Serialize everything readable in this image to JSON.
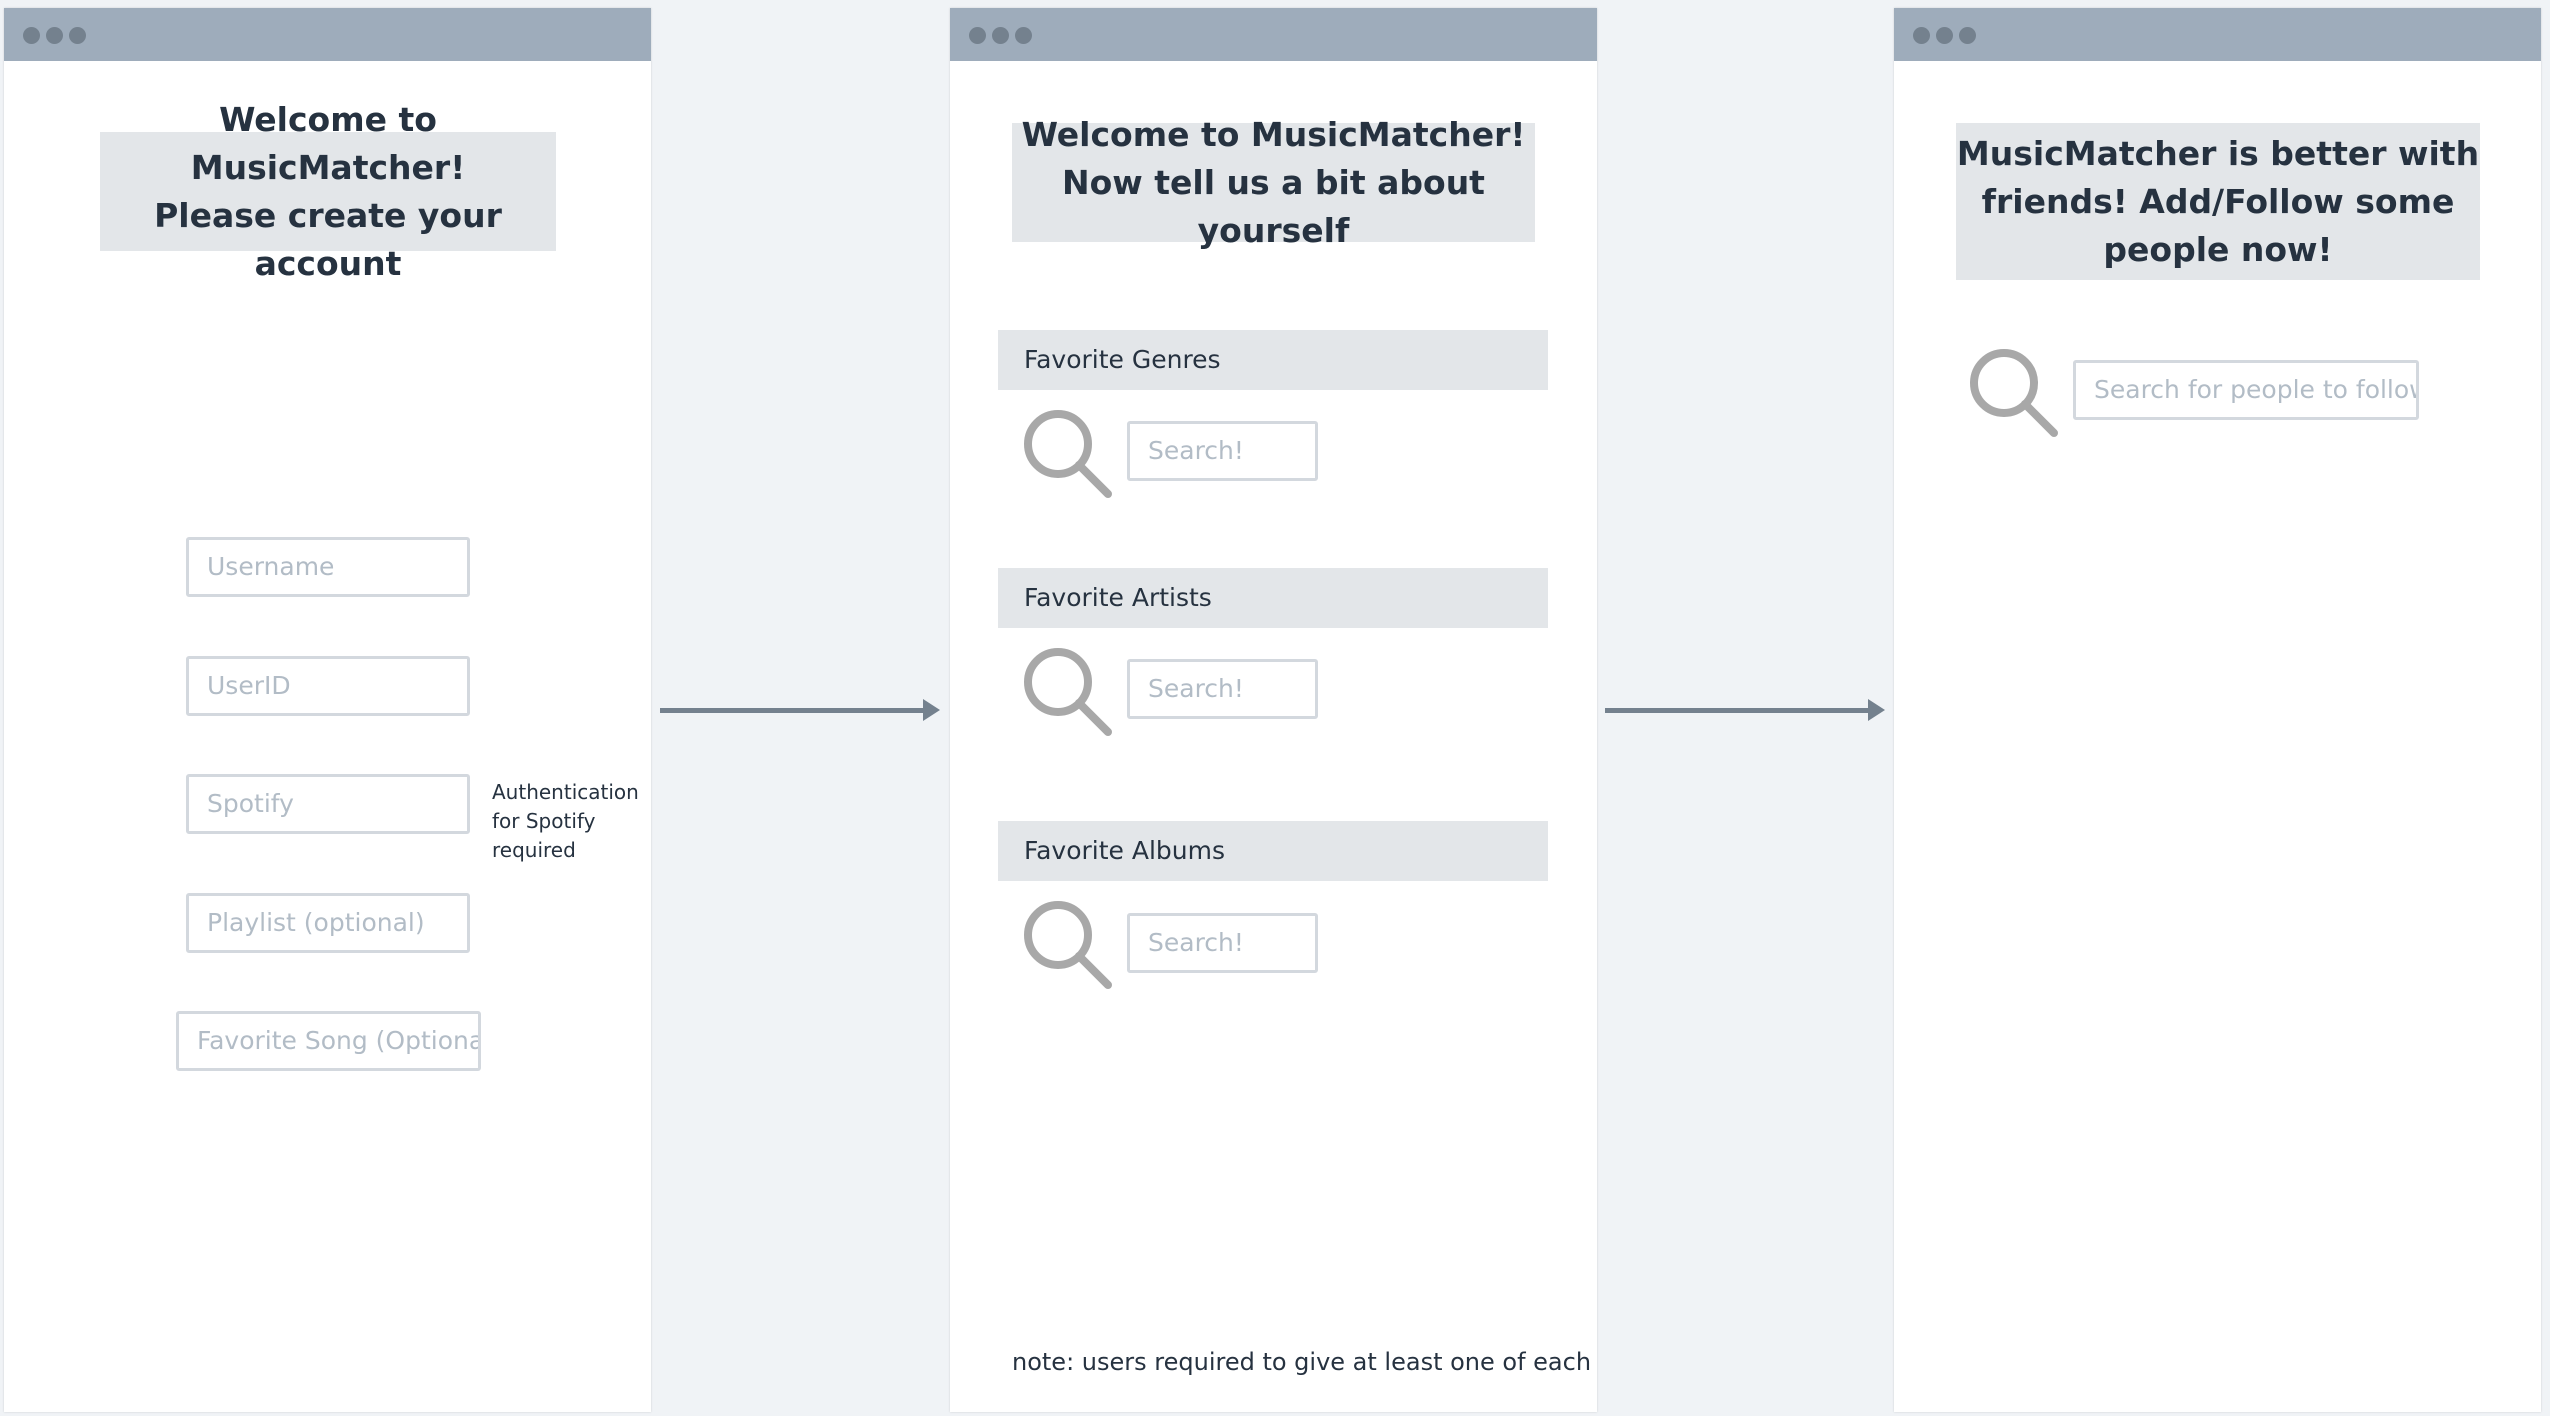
{
  "screens": [
    {
      "banner": {
        "line1": "Welcome to MusicMatcher!",
        "line2": "Please create your account"
      },
      "fields": [
        {
          "placeholder": "Username"
        },
        {
          "placeholder": "UserID"
        },
        {
          "placeholder": "Spotify"
        },
        {
          "placeholder": "Playlist (optional)"
        },
        {
          "placeholder": "Favorite Song (Optional"
        }
      ],
      "spotify_note": {
        "line1": "Authentication",
        "line2": "for Spotify",
        "line3": "required"
      }
    },
    {
      "banner": {
        "line1": "Welcome to MusicMatcher!",
        "line2": "Now tell us a bit about yourself"
      },
      "sections": [
        {
          "label": "Favorite Genres",
          "search_placeholder": "Search!",
          "icon": "magnifier-icon"
        },
        {
          "label": "Favorite Artists",
          "search_placeholder": "Search!",
          "icon": "magnifier-icon"
        },
        {
          "label": "Favorite Albums",
          "search_placeholder": "Search!",
          "icon": "magnifier-icon"
        }
      ],
      "note": "note: users required to give at least one of each"
    },
    {
      "banner": {
        "line1": "MusicMatcher is better with",
        "line2": "friends! Add/Follow some",
        "line3": "people now!"
      },
      "search_placeholder": "Search for people to follow",
      "icon": "magnifier-icon"
    }
  ],
  "colors": {
    "background": "#f0f3f6",
    "titlebar": "#9eacbb",
    "banner": "#e3e6e9",
    "text": "#263240",
    "placeholder": "#b2bcc6",
    "arrow": "#74818e",
    "icon": "#a8a8a8"
  }
}
